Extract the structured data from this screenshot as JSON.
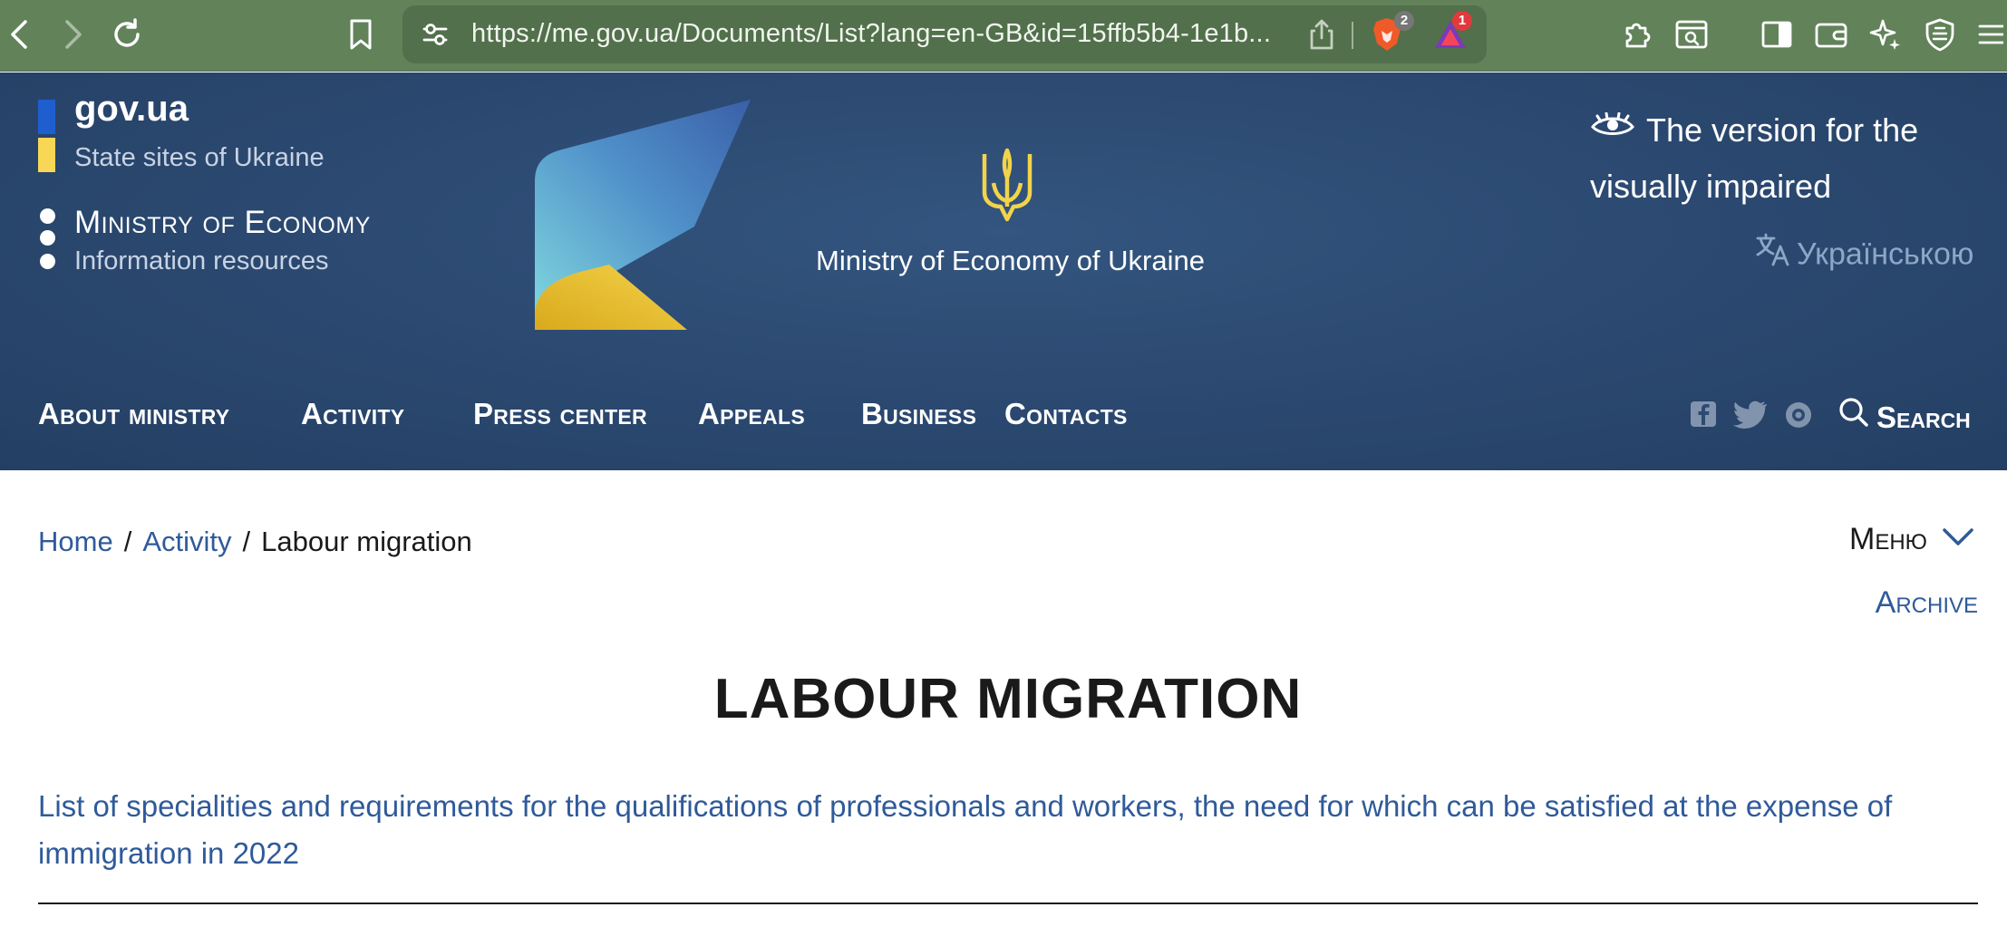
{
  "browser": {
    "url": "https://me.gov.ua/Documents/List?lang=en-GB&id=15ffb5b4-1e1b...",
    "brave_badge": "2",
    "rewards_badge": "1",
    "colors": {
      "chrome": "#62825a",
      "urlbar": "#52704b"
    }
  },
  "header": {
    "gov_brand": "gov.ua",
    "state_sites": "State sites of Ukraine",
    "ministry_name": "Ministry of Economy",
    "info_resources": "Information resources",
    "center_title": "Ministry of Economy of Ukraine",
    "visually_impaired": "The version for the visually impaired",
    "language_switch": "Українською",
    "colors": {
      "background": "#2c4a72",
      "flag_blue": "#1f5ecf",
      "flag_yellow": "#f8d756",
      "trident": "#f3d34a"
    }
  },
  "nav": {
    "items": [
      {
        "label": "About ministry"
      },
      {
        "label": "Activity"
      },
      {
        "label": "Press center"
      },
      {
        "label": "Appeals"
      },
      {
        "label": "Business"
      },
      {
        "label": "Contacts"
      }
    ],
    "social_icons": [
      "facebook-icon",
      "twitter-icon",
      "instagram-icon"
    ],
    "search_label": "Search"
  },
  "breadcrumb": {
    "home": "Home",
    "activity": "Activity",
    "current": "Labour migration",
    "separator": "/"
  },
  "sidebar_toggle": {
    "menu_label": "Меню",
    "archive_label": "Archive"
  },
  "main": {
    "title": "LABOUR MIGRATION",
    "documents": [
      {
        "title": "List of specialities and requirements for the qualifications of professionals and workers, the need for which can be satisfied at the expense of immigration in 2022"
      }
    ],
    "colors": {
      "link": "#2f5a9a",
      "text": "#1a1a1a"
    }
  }
}
